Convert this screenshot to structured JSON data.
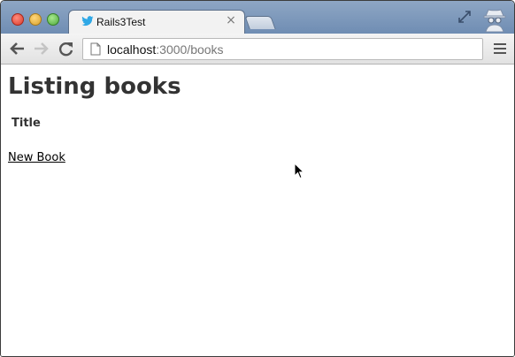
{
  "browser": {
    "tab": {
      "title": "Rails3Test",
      "close_glyph": "×",
      "favicon": "twitter-bird-icon"
    },
    "address_bar": {
      "host": "localhost",
      "path": ":3000/books"
    },
    "colors": {
      "titlebar": "#7f98bb",
      "favicon": "#2fa8e6"
    }
  },
  "page": {
    "heading": "Listing books",
    "table": {
      "headers": [
        "Title"
      ],
      "rows": []
    },
    "new_link": "New Book"
  }
}
